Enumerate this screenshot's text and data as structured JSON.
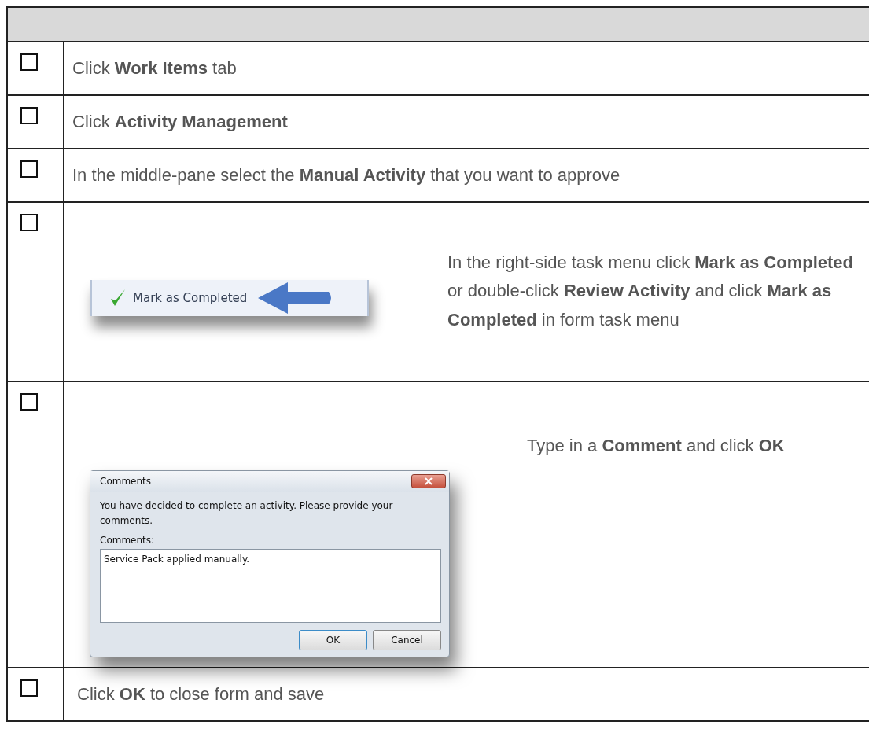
{
  "rows": [
    {
      "kind": "text",
      "checked": false,
      "text": "Click **Work Items** tab"
    },
    {
      "kind": "text",
      "checked": false,
      "text": "Click **Activity Management**"
    },
    {
      "kind": "text",
      "checked": false,
      "text": "In the middle-pane select the **Manual Activity** that you want to approve"
    },
    {
      "kind": "menu_image",
      "checked": false,
      "menu_item": "Mark as Completed",
      "text": "In the right-side task menu click **Mark as Completed** or double-click **Review Activity** and click **Mark as Completed** in form task menu"
    },
    {
      "kind": "dialog_image",
      "checked": false,
      "dialog": {
        "title": "Comments",
        "message": "You have decided to complete an activity. Please provide your comments.",
        "field_label": "Comments:",
        "value": "Service Pack applied manually.",
        "buttons": [
          "OK",
          "Cancel"
        ]
      },
      "text": "Type in a **Comment** and click **OK**"
    },
    {
      "kind": "text",
      "checked": false,
      "text": "Click **OK** to close form and save"
    }
  ]
}
